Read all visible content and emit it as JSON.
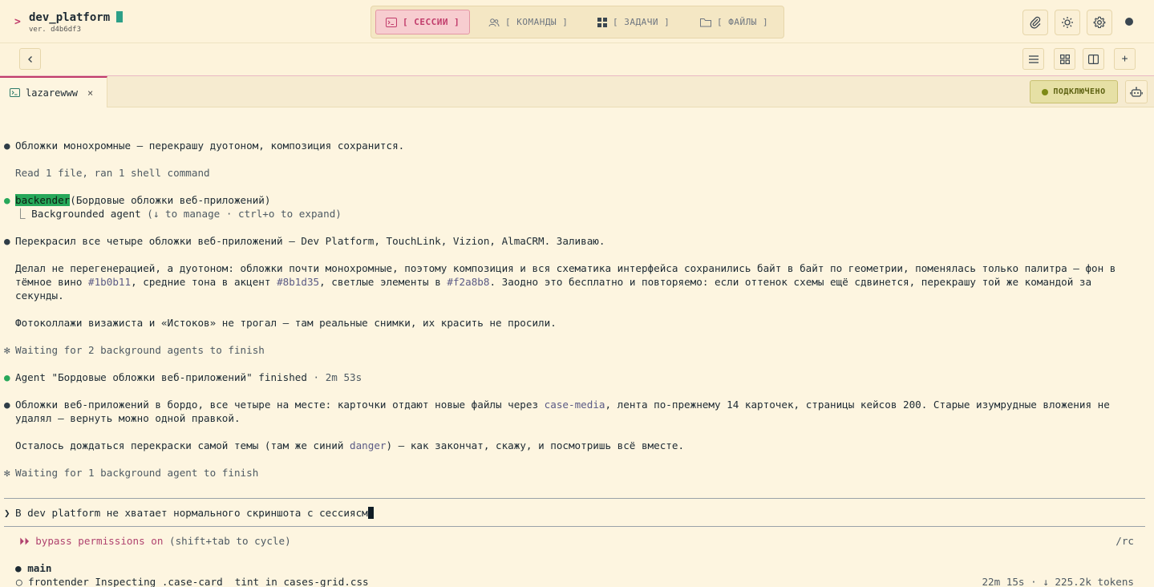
{
  "app": {
    "name": "dev_platform",
    "version": "ver. d4b6df3",
    "prompt_glyph": ">"
  },
  "nav": {
    "tabs": [
      {
        "label": "[ СЕССИИ ]",
        "icon": "terminal-icon",
        "active": true
      },
      {
        "label": "[ КОМАНДЫ ]",
        "icon": "users-icon",
        "active": false
      },
      {
        "label": "[ ЗАДАЧИ ]",
        "icon": "grid-icon",
        "active": false
      },
      {
        "label": "[ ФАЙЛЫ ]",
        "icon": "folder-icon",
        "active": false
      }
    ]
  },
  "header_actions": [
    "paperclip-icon",
    "sun-icon",
    "gear-icon",
    "status-dot"
  ],
  "toolbar": {
    "back": "‹",
    "right_buttons": [
      "list-icon",
      "grid-icon",
      "split-icon",
      "plus-icon"
    ],
    "plus": "+"
  },
  "session": {
    "tab_name": "lazarewww",
    "close": "×",
    "status": "ПОДКЛЮЧЕНО"
  },
  "terminal": {
    "bullet": "●",
    "spinner": "✻",
    "l1": "Обложки монохромные — перекрашу дуотоном, композиция сохранится.",
    "l2": "Read 1 file, ran 1 shell command",
    "agent_name": "backender",
    "agent_task": "(Бордовые обложки веб-приложений)",
    "agent_sub_prefix": "⎿  Backgrounded agent ",
    "agent_sub_hint": "(↓ to manage · ctrl+o to expand)",
    "l4": "Перекрасил все четыре обложки веб-приложений — Dev Platform, TouchLink, Vizion, AlmaCRM. Заливаю.",
    "p5_a": "Делал не перегенерацией, а дуотоном: обложки почти монохромные, поэтому композиция и вся схематика интерфейса сохранились байт в байт по геометрии, поменялась только палитра — фон в тёмное вино ",
    "p5_hex1": "#1b0b11",
    "p5_b": ", средние тона в акцент ",
    "p5_hex2": "#8b1d35",
    "p5_c": ", светлые элементы в ",
    "p5_hex3": "#f2a8b8",
    "p5_d": ". Заодно это бесплатно и повторяемо: если оттенок схемы ещё сдвинется, перекрашу той же командой за секунды.",
    "l6": "Фотоколлажи визажиста и «Истоков» не трогал — там реальные снимки, их красить не просили.",
    "wait1": "Waiting for 2 background agents to finish",
    "finished_a": "Agent \"Бордовые обложки веб-приложений\" finished ",
    "finished_b": "· 2m 53s",
    "p8_a": "Обложки веб-приложений в бордо, все четыре на месте: карточки отдают новые файлы через ",
    "p8_code": "case-media",
    "p8_b": ", лента по-прежнему 14 карточек, страницы кейсов 200. Старые изумрудные вложения не удалял — вернуть можно одной правкой.",
    "p9_a": "Осталось дождаться перекраски самой темы (там же синий ",
    "p9_code": "danger",
    "p9_b": ") — как закончат, скажу, и посмотришь всё вместе.",
    "wait2": "Waiting for 1 background agent to finish",
    "input_caret": "❯",
    "input_value": "В dev platform не хватает нормального скриншота с сессиясм",
    "perm_glyph": "⏵⏵",
    "perm_text": "bypass permissions on",
    "perm_hint": "(shift+tab to cycle)",
    "rc": "/rc",
    "branch_bullet": "●",
    "branch": "main",
    "agent2_glyph": "◯",
    "agent2_name": "frontender",
    "agent2_task": "Inspecting .case-card__tint in cases-grid.css",
    "agent2_stats": "22m 15s · ↓ 225.2k tokens"
  }
}
